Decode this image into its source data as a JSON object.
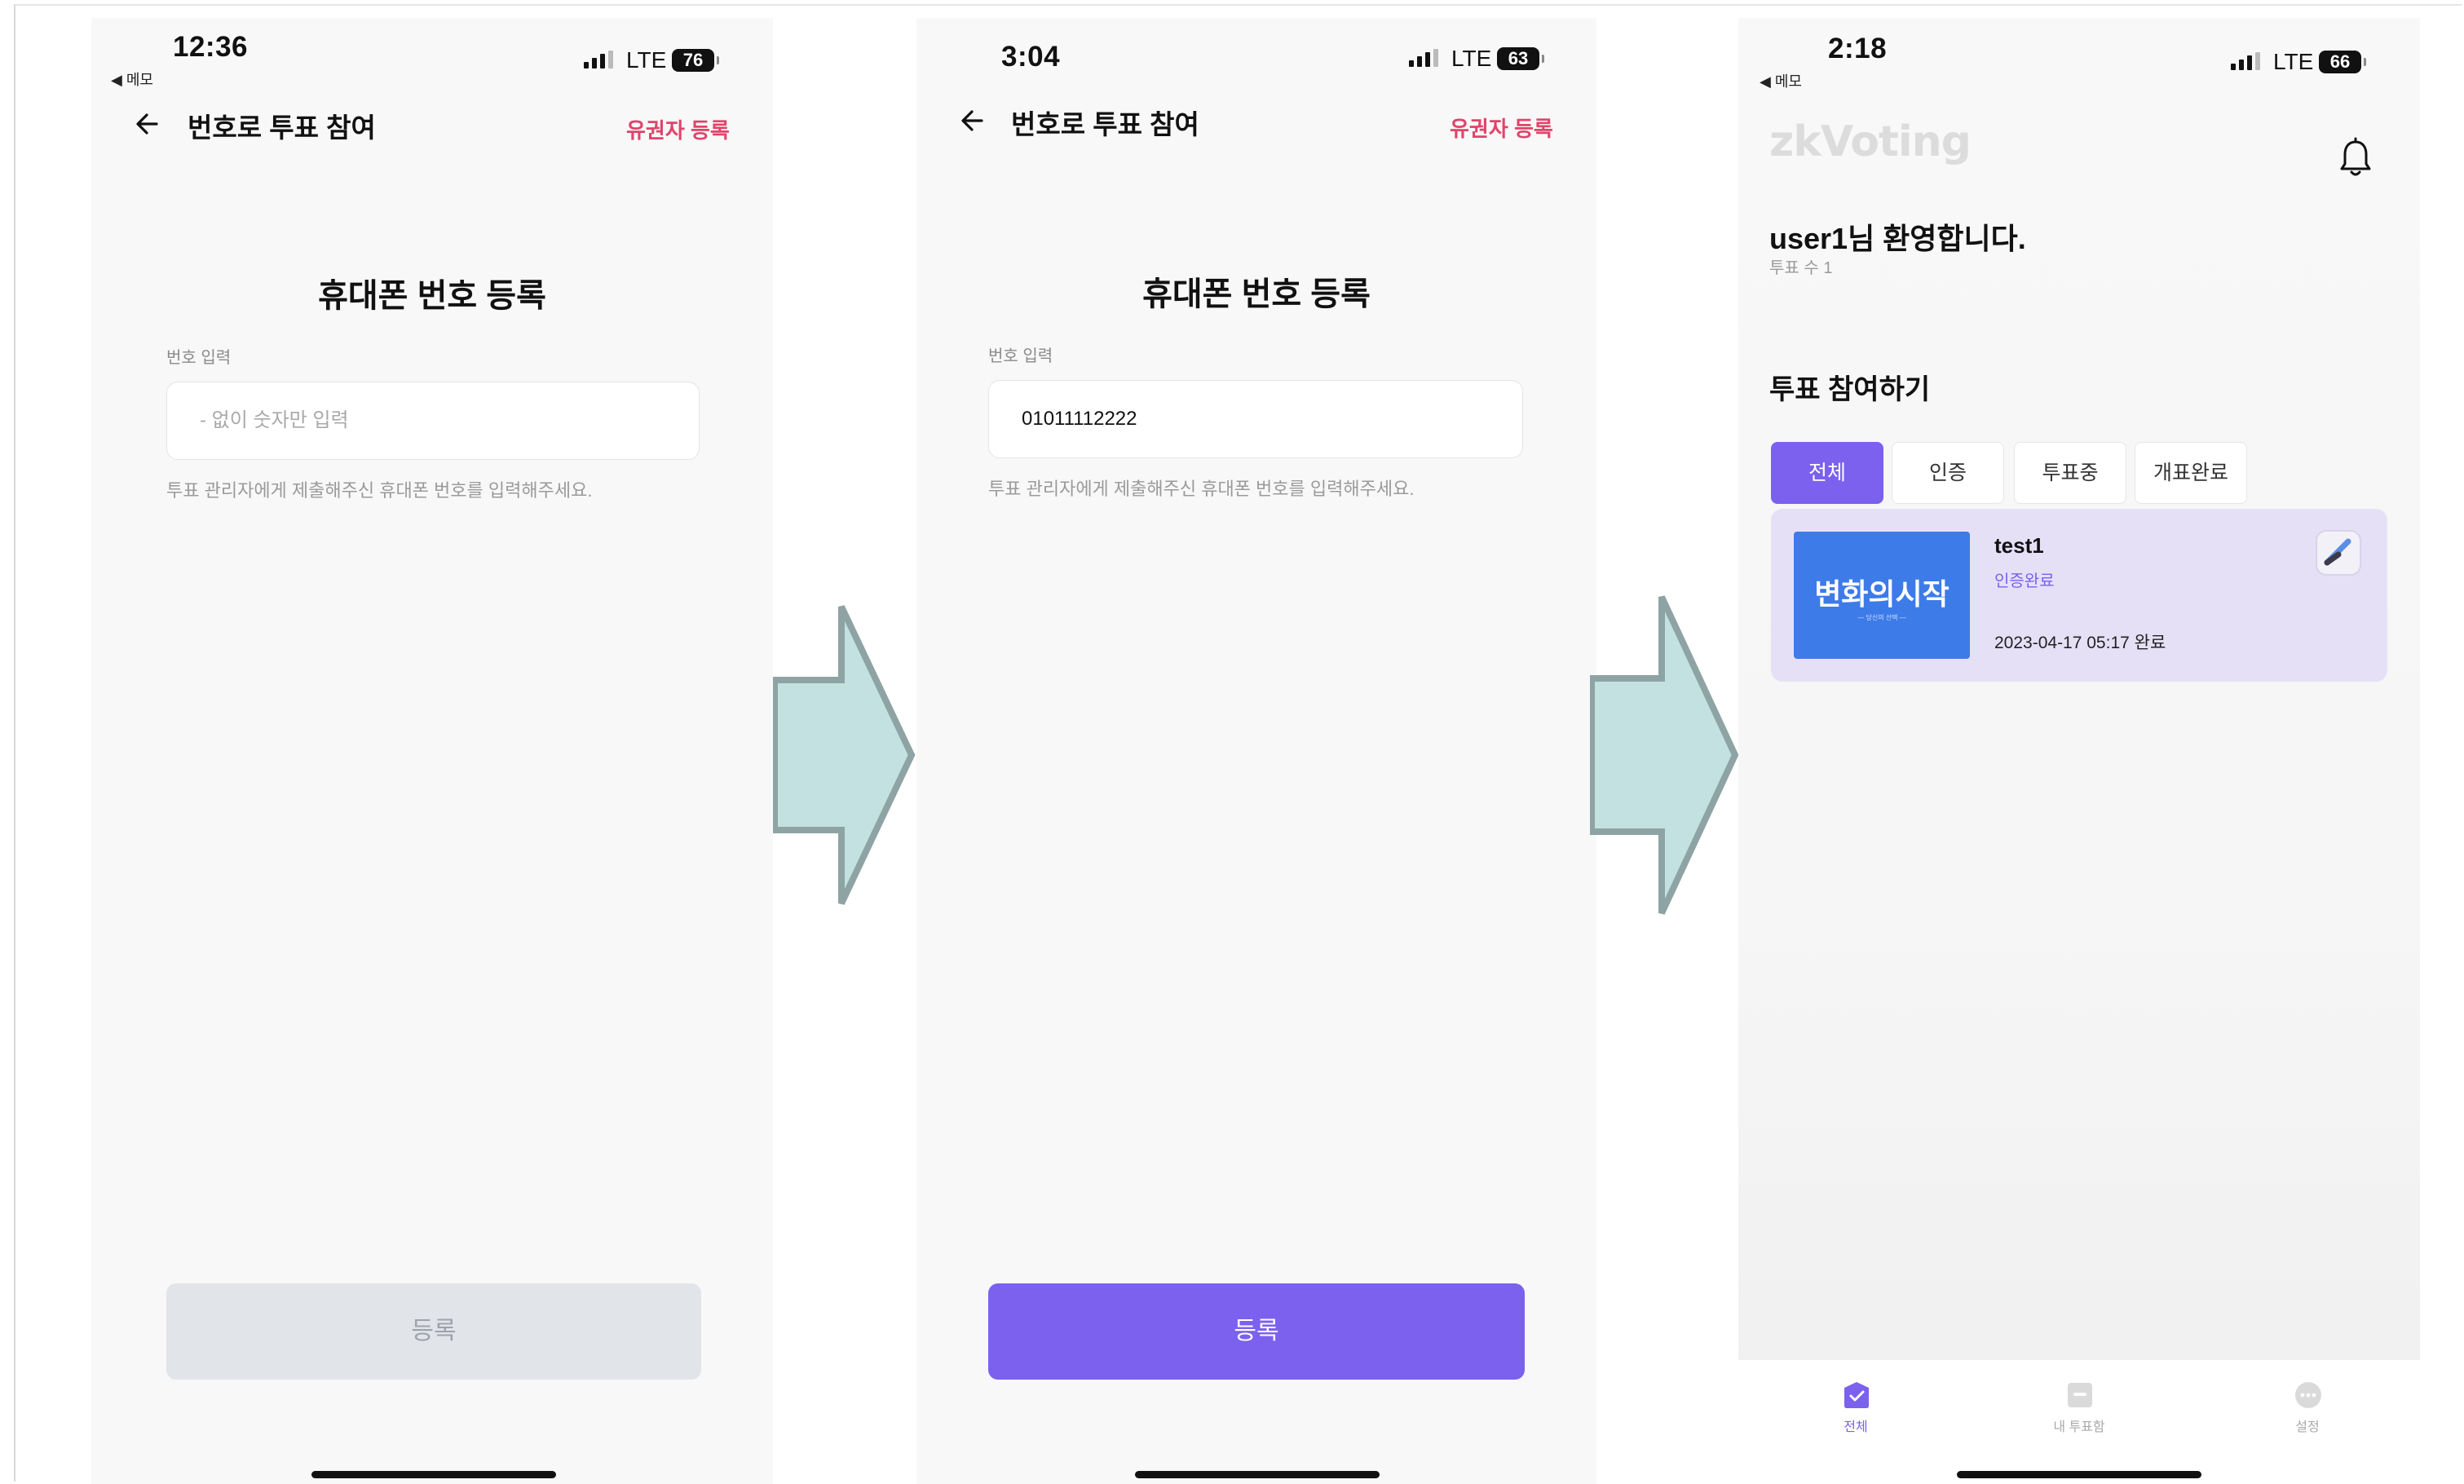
{
  "screen1": {
    "status": {
      "time": "12:36",
      "back_app": "◀ 메모",
      "network": "LTE",
      "battery": "76"
    },
    "nav": {
      "title": "번호로 투표 참여",
      "right_link": "유권자 등록"
    },
    "heading": "휴대폰 번호 등록",
    "field_label": "번호 입력",
    "input_placeholder": "- 없이 숫자만 입력",
    "help_text": "투표 관리자에게 제출해주신 휴대폰 번호를 입력해주세요.",
    "submit_label": "등록"
  },
  "screen2": {
    "status": {
      "time": "3:04",
      "network": "LTE",
      "battery": "63"
    },
    "nav": {
      "title": "번호로 투표 참여",
      "right_link": "유권자 등록"
    },
    "heading": "휴대폰 번호 등록",
    "field_label": "번호 입력",
    "input_value": "01011112222",
    "help_text": "투표 관리자에게 제출해주신 휴대폰 번호를 입력해주세요.",
    "submit_label": "등록"
  },
  "screen3": {
    "status": {
      "time": "2:18",
      "back_app": "◀ 메모",
      "network": "LTE",
      "battery": "66"
    },
    "logo": "zkVoting",
    "welcome": "user1님 환영합니다.",
    "vote_count": "투표 수 1",
    "section_title": "투표 참여하기",
    "tabs": [
      {
        "label": "전체",
        "active": true
      },
      {
        "label": "인증",
        "active": false
      },
      {
        "label": "투표중",
        "active": false
      },
      {
        "label": "개표완료",
        "active": false
      }
    ],
    "card": {
      "thumb_text": "변화의시작",
      "thumb_subtext": "— 당신의 선택 —",
      "title": "test1",
      "status": "인증완료",
      "date": "2023-04-17 05:17 완료"
    },
    "bottom_nav": [
      {
        "label": "전체",
        "icon": "check-ballot-icon",
        "active": true
      },
      {
        "label": "내 투표함",
        "icon": "ballot-box-icon",
        "active": false
      },
      {
        "label": "설정",
        "icon": "more-icon",
        "active": false
      }
    ]
  },
  "colors": {
    "accent": "#7b61ee",
    "link": "#e0446a",
    "arrow_fill": "#c3e1e1",
    "arrow_stroke": "#8ea3a4"
  }
}
